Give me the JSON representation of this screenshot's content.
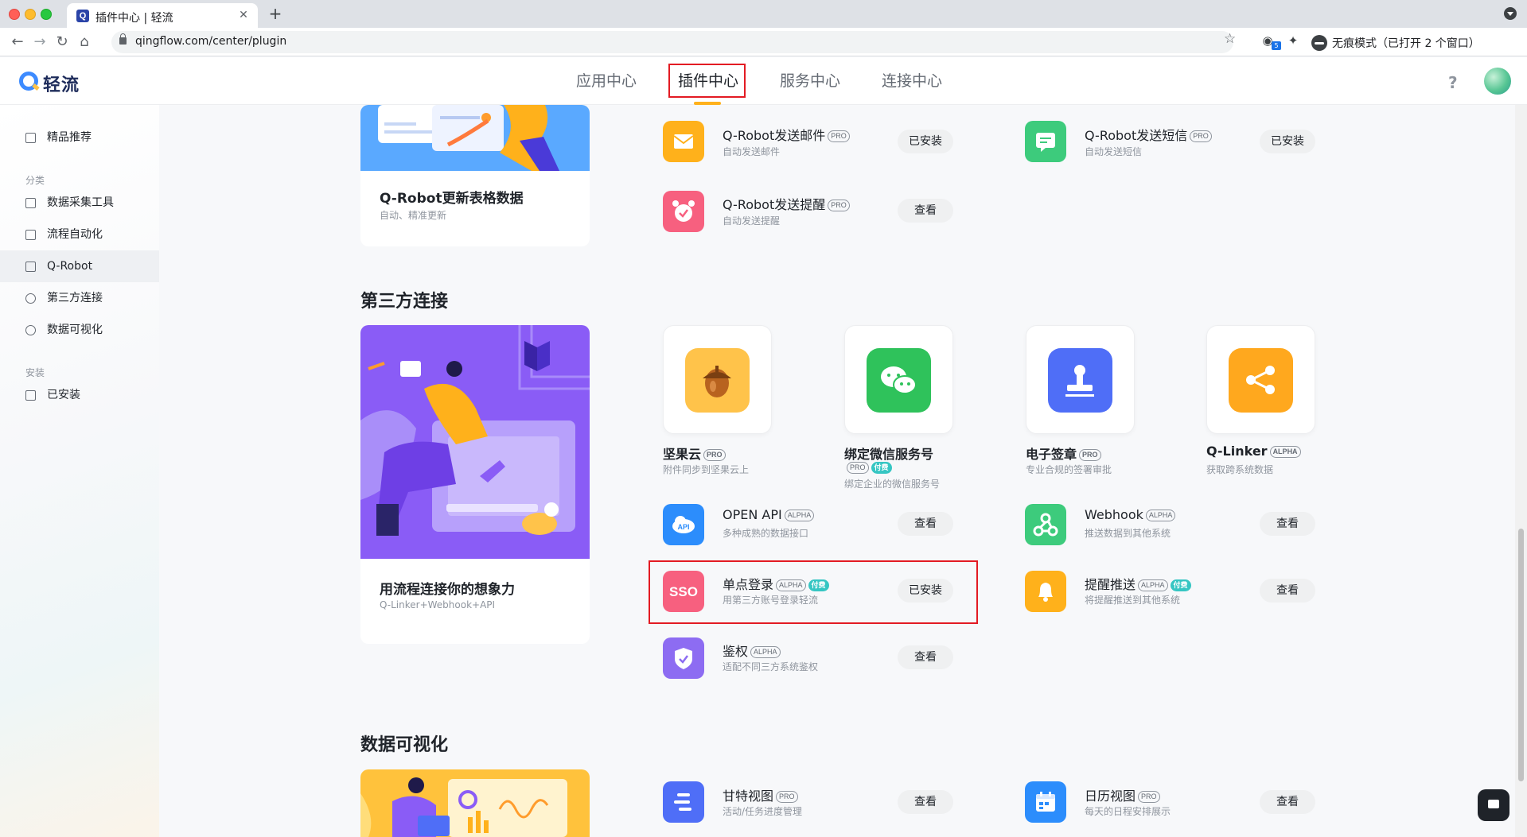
{
  "browser": {
    "tab_title": "插件中心 | 轻流",
    "url": "qingflow.com/center/plugin",
    "incognito_label": "无痕模式（已打开 2 个窗口）",
    "extension_badge": "5"
  },
  "header": {
    "logo_text": "轻流",
    "nav": [
      {
        "label": "应用中心"
      },
      {
        "label": "插件中心"
      },
      {
        "label": "服务中心"
      },
      {
        "label": "连接中心"
      }
    ],
    "help": "?"
  },
  "sidebar": {
    "featured": "精品推荐",
    "category_heading": "分类",
    "categories": [
      {
        "label": "数据采集工具"
      },
      {
        "label": "流程自动化"
      },
      {
        "label": "Q-Robot"
      },
      {
        "label": "第三方连接"
      },
      {
        "label": "数据可视化"
      }
    ],
    "install_heading": "安装",
    "installed": "已安装"
  },
  "qrobot": {
    "hero_title": "Q-Robot更新表格数据",
    "hero_sub": "自动、精准更新",
    "items": [
      {
        "name": "Q-Robot发送邮件",
        "tag": "PRO",
        "desc": "自动发送邮件",
        "button": "已安装",
        "color": "#ffb11b"
      },
      {
        "name": "Q-Robot发送短信",
        "tag": "PRO",
        "desc": "自动发送短信",
        "button": "已安装",
        "color": "#3dcb7c"
      },
      {
        "name": "Q-Robot发送提醒",
        "tag": "PRO",
        "desc": "自动发送提醒",
        "button": "查看",
        "color": "#f7607f"
      }
    ]
  },
  "thirdparty": {
    "title": "第三方连接",
    "hero_title": "用流程连接你的想象力",
    "hero_sub": "Q-Linker+Webhook+API",
    "tiles": [
      {
        "name": "坚果云",
        "tags": [
          "PRO"
        ],
        "desc": "附件同步到坚果云上",
        "color": "#ffc34a"
      },
      {
        "name": "绑定微信服务号",
        "tags": [
          "PRO",
          "付费"
        ],
        "desc": "绑定企业的微信服务号",
        "color": "#2fc25b"
      },
      {
        "name": "电子签章",
        "tags": [
          "PRO"
        ],
        "desc": "专业合规的签署审批",
        "color": "#4f6ef7"
      },
      {
        "name": "Q-Linker",
        "tags": [
          "ALPHA"
        ],
        "desc": "获取跨系统数据",
        "color": "#ffa81e"
      }
    ],
    "items": [
      {
        "name": "OPEN API",
        "tag": "ALPHA",
        "paid": "",
        "desc": "多种成熟的数据接口",
        "button": "查看",
        "color": "#2c8dfc",
        "icon_text": "API"
      },
      {
        "name": "Webhook",
        "tag": "ALPHA",
        "paid": "",
        "desc": "推送数据到其他系统",
        "button": "查看",
        "color": "#3dcb7c",
        "icon_text": ""
      },
      {
        "name": "单点登录",
        "tag": "ALPHA",
        "paid": "付费",
        "desc": "用第三方账号登录轻流",
        "button": "已安装",
        "color": "#f7607f",
        "icon_text": "SSO"
      },
      {
        "name": "提醒推送",
        "tag": "ALPHA",
        "paid": "付费",
        "desc": "将提醒推送到其他系统",
        "button": "查看",
        "color": "#ffb11b",
        "icon_text": ""
      },
      {
        "name": "鉴权",
        "tag": "ALPHA",
        "paid": "",
        "desc": "适配不同三方系统鉴权",
        "button": "查看",
        "color": "#8d6cf2",
        "icon_text": ""
      }
    ]
  },
  "dataviz": {
    "title": "数据可视化",
    "items": [
      {
        "name": "甘特视图",
        "tag": "PRO",
        "desc": "活动/任务进度管理",
        "button": "查看",
        "color": "#4f6ef7"
      },
      {
        "name": "日历视图",
        "tag": "PRO",
        "desc": "每天的日程安排展示",
        "button": "查看",
        "color": "#2c8dfc"
      }
    ]
  }
}
